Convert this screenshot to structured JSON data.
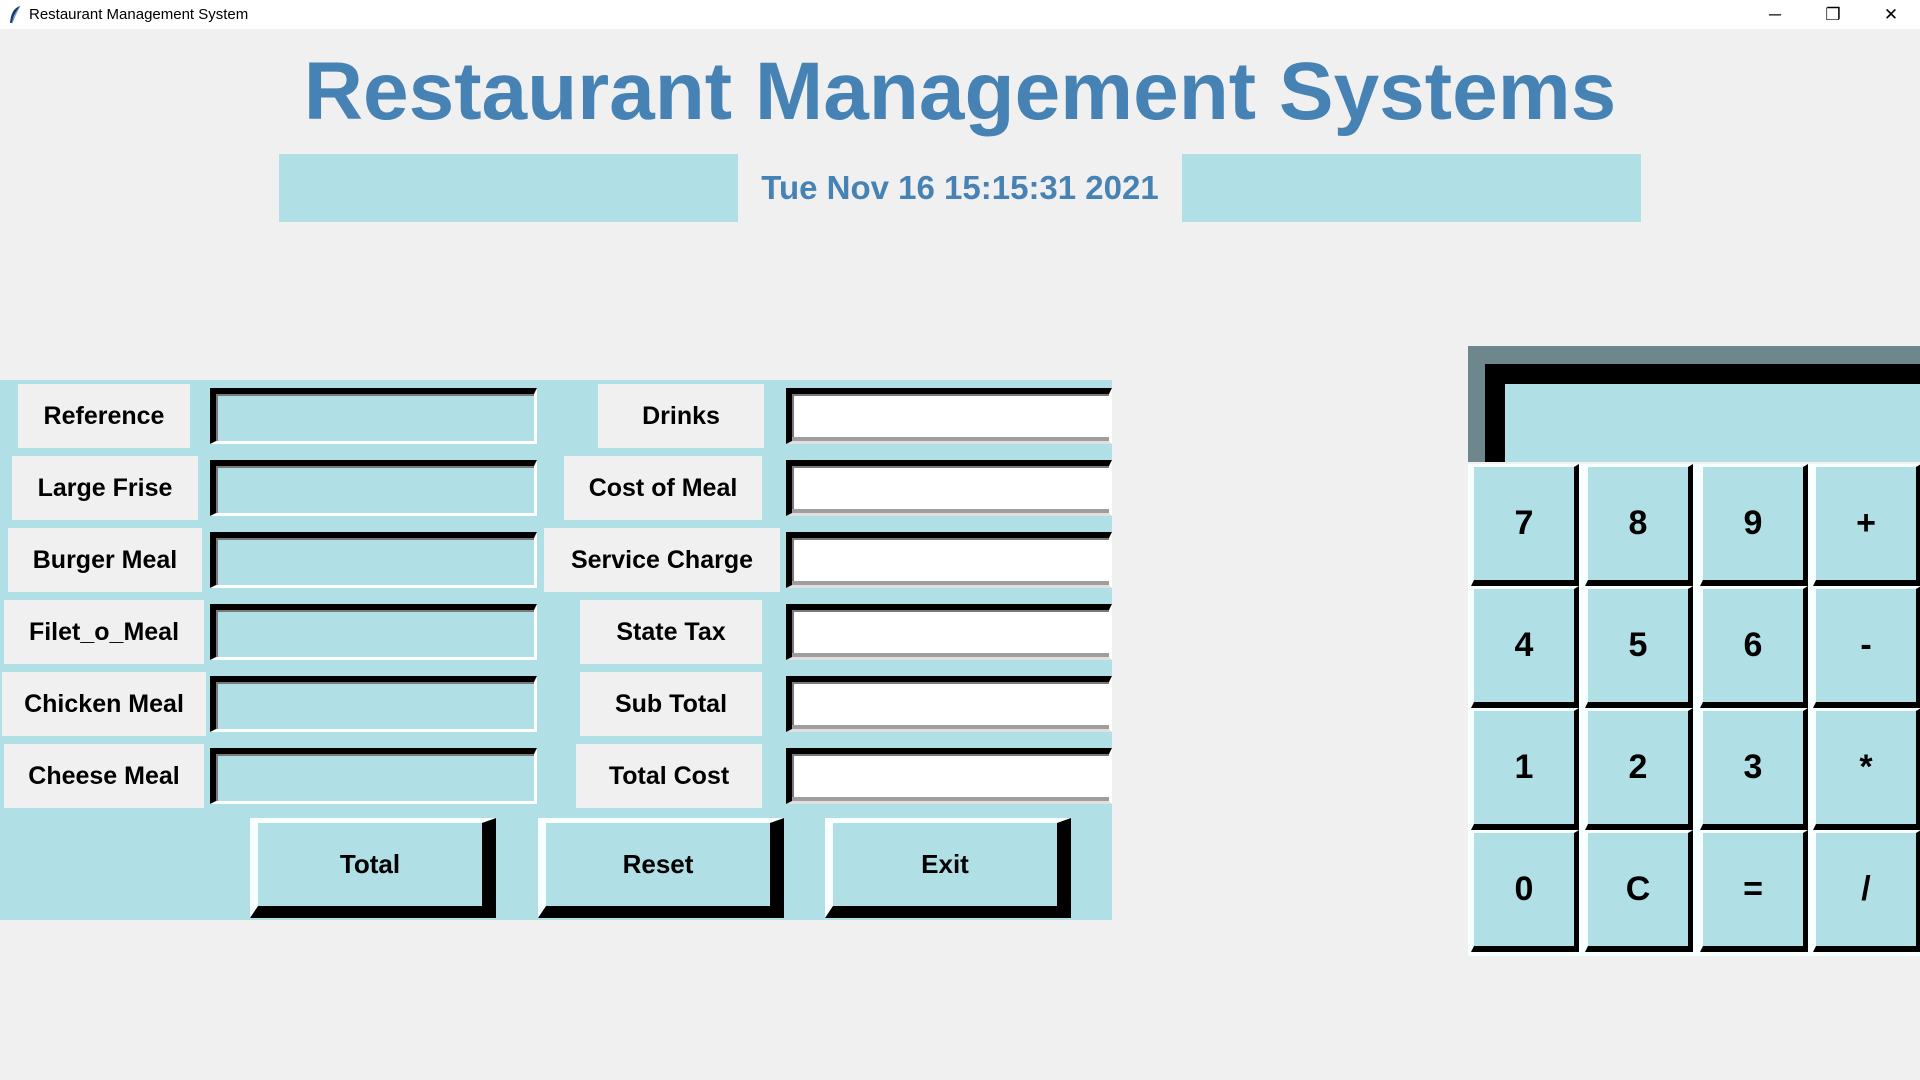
{
  "window": {
    "title": "Restaurant Management System",
    "minimize": "─",
    "restore": "❐",
    "close": "✕"
  },
  "header": {
    "title": "Restaurant Management Systems",
    "datetime": "Tue Nov 16 15:15:31 2021"
  },
  "form": {
    "left": [
      {
        "label": "Reference",
        "value": ""
      },
      {
        "label": "Large Frise",
        "value": ""
      },
      {
        "label": "Burger Meal",
        "value": ""
      },
      {
        "label": "Filet_o_Meal",
        "value": ""
      },
      {
        "label": "Chicken Meal",
        "value": ""
      },
      {
        "label": "Cheese Meal",
        "value": ""
      }
    ],
    "right": [
      {
        "label": "Drinks",
        "value": ""
      },
      {
        "label": "Cost of Meal",
        "value": ""
      },
      {
        "label": "Service Charge",
        "value": ""
      },
      {
        "label": "State Tax",
        "value": ""
      },
      {
        "label": "Sub Total",
        "value": ""
      },
      {
        "label": "Total Cost",
        "value": ""
      }
    ]
  },
  "buttons": {
    "total": "Total",
    "reset": "Reset",
    "exit": "Exit"
  },
  "calculator": {
    "display": "",
    "keys": [
      "7",
      "8",
      "9",
      "+",
      "4",
      "5",
      "6",
      "-",
      "1",
      "2",
      "3",
      "*",
      "0",
      "C",
      "=",
      "/"
    ]
  },
  "colors": {
    "accent": "#4682b4",
    "panel": "#b0dfe5",
    "background": "#f0f0f0"
  }
}
